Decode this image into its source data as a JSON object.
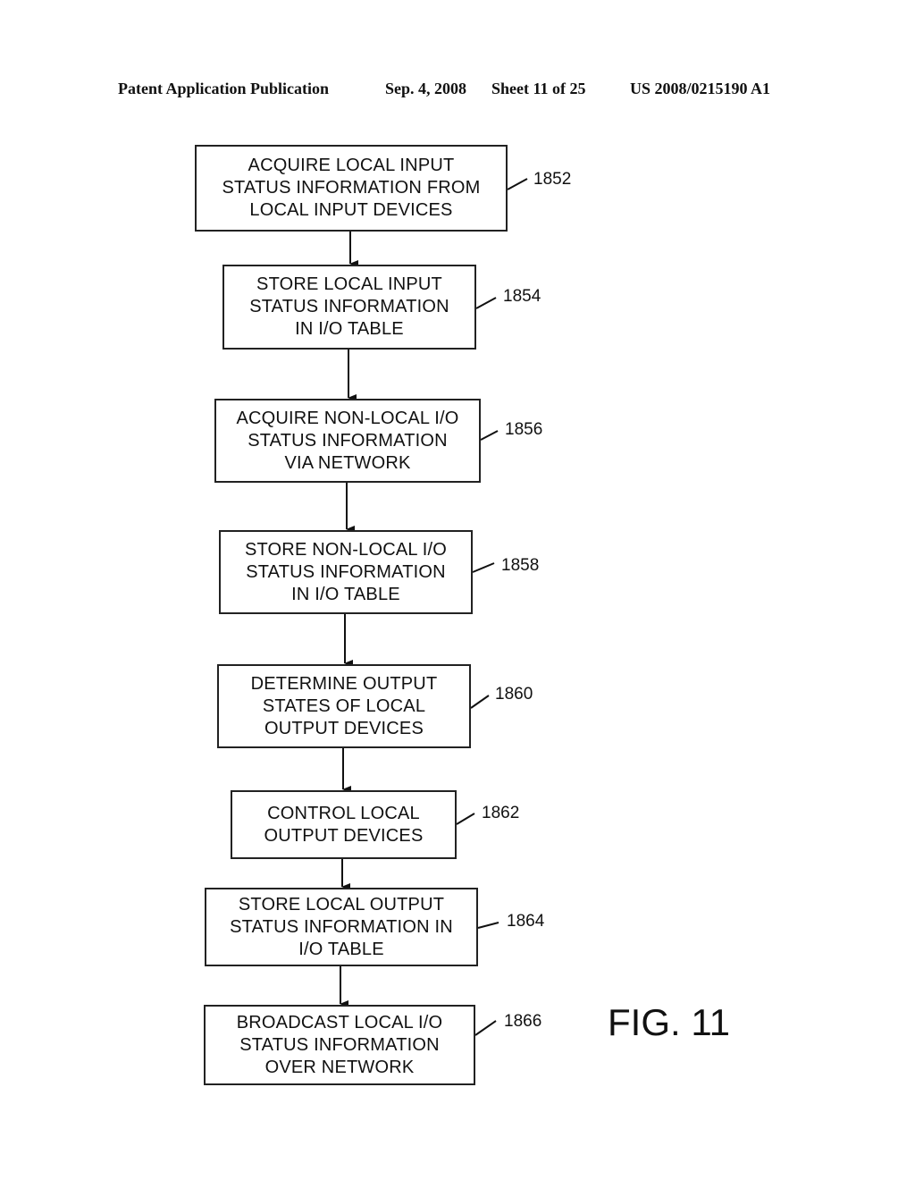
{
  "header": {
    "publication": "Patent Application Publication",
    "date": "Sep. 4, 2008",
    "sheet": "Sheet 11 of 25",
    "number": "US 2008/0215190 A1"
  },
  "figure_label": "FIG. 11",
  "steps": [
    {
      "ref": "1852",
      "lines": [
        "ACQUIRE LOCAL INPUT",
        "STATUS INFORMATION FROM",
        "LOCAL INPUT DEVICES"
      ]
    },
    {
      "ref": "1854",
      "lines": [
        "STORE LOCAL INPUT",
        "STATUS INFORMATION",
        "IN I/O TABLE"
      ]
    },
    {
      "ref": "1856",
      "lines": [
        "ACQUIRE NON-LOCAL I/O",
        "STATUS INFORMATION",
        "VIA NETWORK"
      ]
    },
    {
      "ref": "1858",
      "lines": [
        "STORE NON-LOCAL I/O",
        "STATUS INFORMATION",
        "IN I/O TABLE"
      ]
    },
    {
      "ref": "1860",
      "lines": [
        "DETERMINE OUTPUT",
        "STATES OF LOCAL",
        "OUTPUT DEVICES"
      ]
    },
    {
      "ref": "1862",
      "lines": [
        "CONTROL LOCAL",
        "OUTPUT DEVICES"
      ]
    },
    {
      "ref": "1864",
      "lines": [
        "STORE LOCAL OUTPUT",
        "STATUS INFORMATION IN",
        "I/O TABLE"
      ]
    },
    {
      "ref": "1866",
      "lines": [
        "BROADCAST LOCAL I/O",
        "STATUS INFORMATION",
        "OVER NETWORK"
      ]
    }
  ]
}
